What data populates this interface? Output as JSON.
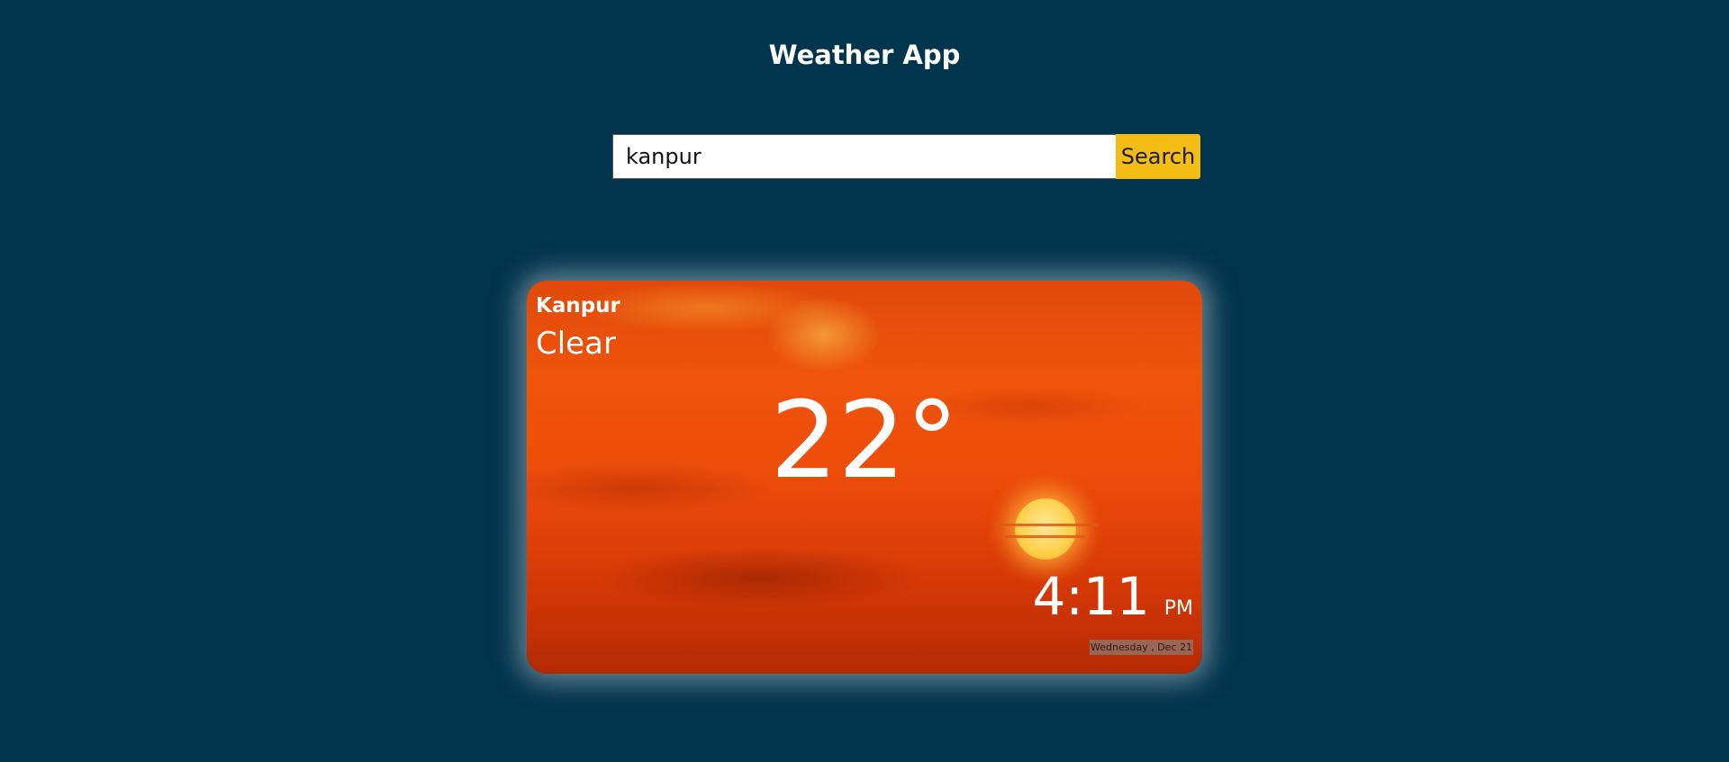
{
  "header": {
    "title": "Weather App"
  },
  "search": {
    "value": "kanpur",
    "button_label": "Search"
  },
  "weather": {
    "city": "Kanpur",
    "condition": "Clear",
    "temperature": "22°",
    "time": "4:11",
    "ampm": "PM",
    "date": "Wednesday , Dec 21"
  },
  "colors": {
    "background": "#01344d",
    "search_button": "#f4bd16",
    "card_sky": "#e84c0a"
  }
}
